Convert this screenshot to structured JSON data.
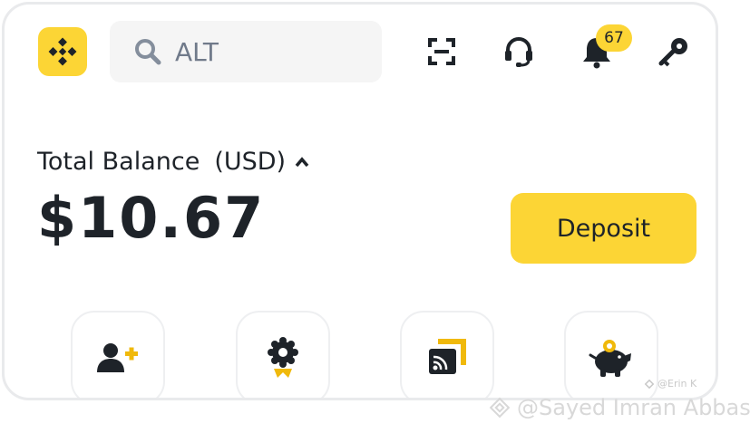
{
  "header": {
    "search_placeholder": "ALT",
    "notification_count": "67"
  },
  "balance": {
    "label": "Total Balance",
    "currency": "(USD)",
    "amount": "$10.67"
  },
  "deposit_label": "Deposit",
  "quick_actions": [
    {
      "icon": "add-user-icon"
    },
    {
      "icon": "award-badge-icon"
    },
    {
      "icon": "broadcast-icon"
    },
    {
      "icon": "piggy-bank-icon"
    }
  ],
  "watermark": {
    "mini": "@Erin K",
    "text": "@Sayed Imran Abbas"
  },
  "colors": {
    "accent": "#fcd535",
    "text": "#1e2329",
    "muted": "#707a8a",
    "search_bg": "#f5f5f5"
  }
}
